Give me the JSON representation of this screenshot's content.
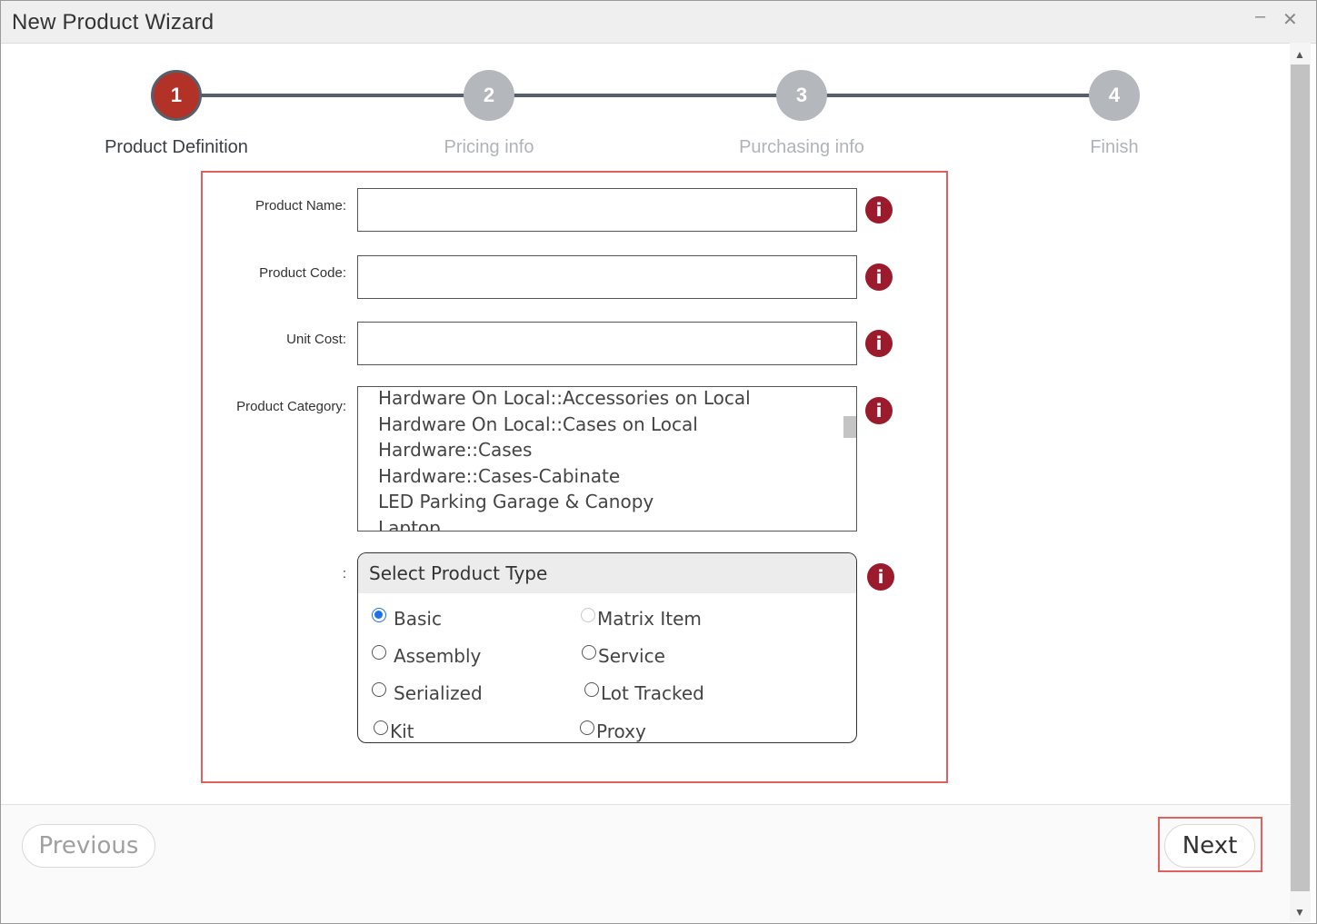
{
  "window": {
    "title": "New Product Wizard",
    "minimize_glyph": "–",
    "close_glyph": "✕"
  },
  "steps": [
    {
      "number": "1",
      "label": "Product Definition",
      "state": "active"
    },
    {
      "number": "2",
      "label": "Pricing info",
      "state": "inactive"
    },
    {
      "number": "3",
      "label": "Purchasing info",
      "state": "inactive"
    },
    {
      "number": "4",
      "label": "Finish",
      "state": "inactive"
    }
  ],
  "form": {
    "product_name": {
      "label": "Product Name:",
      "value": ""
    },
    "product_code": {
      "label": "Product Code:",
      "value": ""
    },
    "unit_cost": {
      "label": "Unit Cost:",
      "value": ""
    },
    "product_category": {
      "label": "Product Category:",
      "options": [
        "Hardware On Local::Accessories on Local",
        "Hardware On Local::Cases on Local",
        "Hardware::Cases",
        "Hardware::Cases-Cabinate",
        "LED Parking Garage & Canopy",
        "Laptop"
      ]
    },
    "product_type": {
      "label": ":",
      "header": "Select Product Type",
      "options": [
        {
          "label": "Basic",
          "selected": true,
          "disabled": false
        },
        {
          "label": "Matrix Item",
          "selected": false,
          "disabled": true
        },
        {
          "label": "Assembly",
          "selected": false,
          "disabled": false
        },
        {
          "label": "Service",
          "selected": false,
          "disabled": false
        },
        {
          "label": "Serialized",
          "selected": false,
          "disabled": false
        },
        {
          "label": "Lot Tracked",
          "selected": false,
          "disabled": false
        },
        {
          "label": "Kit",
          "selected": false,
          "disabled": false
        },
        {
          "label": "Proxy",
          "selected": false,
          "disabled": false
        }
      ]
    },
    "info_glyph": "i"
  },
  "footer": {
    "previous_label": "Previous",
    "next_label": "Next"
  },
  "colors": {
    "active_step": "#b23227",
    "inactive_step": "#b4b7bb",
    "info_icon": "#9b1b2c",
    "highlight_border": "#e06060",
    "radio_selected": "#1a73e8"
  },
  "icons": {
    "info": "info-icon",
    "minimize": "minimize-icon",
    "close": "close-icon"
  }
}
